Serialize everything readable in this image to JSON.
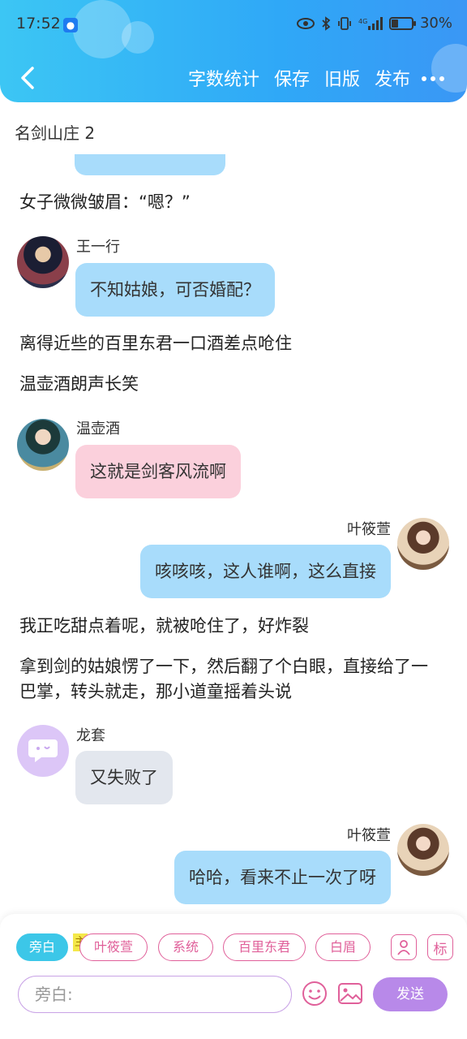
{
  "status": {
    "time": "17:52",
    "battery": "30%",
    "battery_level": 0.3
  },
  "toolbar": {
    "actions": [
      "字数统计",
      "保存",
      "旧版",
      "发布"
    ]
  },
  "chapter": {
    "title": "名剑山庄 2"
  },
  "chat": {
    "narration": [
      "女子微微皱眉：“嗯？”",
      "离得近些的百里东君一口酒差点呛住",
      "温壶酒朗声长笑",
      "我正吃甜点着呢，就被呛住了，好炸裂",
      "拿到剑的姑娘愣了一下，然后翻了个白眼，直接给了一巴掌，转头就走，那小道童摇着头说"
    ],
    "messages": [
      {
        "name": "王一行",
        "text": "不知姑娘，可否婚配？"
      },
      {
        "name": "温壶酒",
        "text": "这就是剑客风流啊"
      },
      {
        "name": "叶筱萱",
        "text": "咳咳咳，这人谁啊，这么直接"
      },
      {
        "name": "龙套",
        "text": "又失败了"
      },
      {
        "name": "叶筱萱",
        "text": "哈哈，看来不止一次了呀"
      }
    ]
  },
  "composer": {
    "roles": [
      "旁白",
      "叶筱萱",
      "系统",
      "百里东君",
      "白眉"
    ],
    "host_tag": "主",
    "tag_icon_label": "标",
    "placeholder": "旁白:",
    "send_label": "发送"
  },
  "colors": {
    "header_start": "#3cc6f4",
    "header_end": "#3a97f5",
    "blue_bubble": "#a8dcfb",
    "pink_bubble": "#fbd0dc",
    "gray_bubble": "#e3e7ee",
    "accent_pink": "#e0609a",
    "send_purple": "#b889e9"
  }
}
